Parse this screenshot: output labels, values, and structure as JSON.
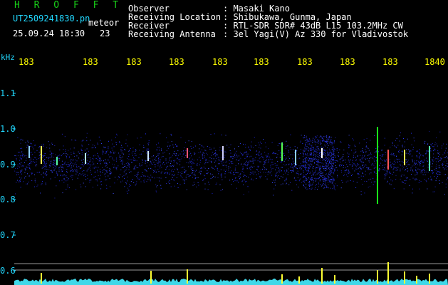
{
  "header": {
    "app_title": "H R O F F T",
    "filename": "UT2509241830.pn",
    "meteor_label": "meteor",
    "date_time": "25.09.24 18:30",
    "count_value": "23",
    "info_labels": [
      "Observer",
      "Receiving Location",
      "Receiver",
      "Receiving Antenna"
    ],
    "info_values": [
      ": Masaki Kano",
      ": Shibukawa, Gunma, Japan",
      ": RTL-SDR SDR# 43dB L15 103.2MHz CW",
      ": 3el Yagi(V) Az 330 for Vladivostok"
    ]
  },
  "axes": {
    "unit": "kHz",
    "y_ticks": [
      "1.1",
      "1.0",
      "0.9",
      "0.8",
      "0.7",
      "0.6"
    ],
    "x_ticks": [
      "183",
      "183",
      "183",
      "183",
      "183",
      "183",
      "183",
      "183",
      "183",
      "1840"
    ]
  },
  "colors": {
    "background": "#000000",
    "header_text": "#ffffff",
    "title_green": "#19d219",
    "time_ticks": "#ffff00",
    "axis_cyan": "#21d8ff",
    "noise_blue": "#1e2bff",
    "baseline_cyan": "#3fd8e8"
  }
}
